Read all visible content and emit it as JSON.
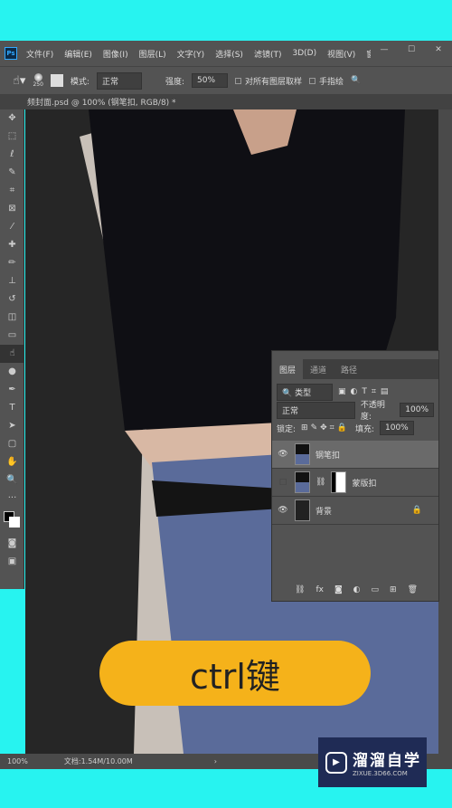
{
  "menubar": {
    "logo": "Ps",
    "items": [
      "文件(F)",
      "编辑(E)",
      "图像(I)",
      "图层(L)",
      "文字(Y)",
      "选择(S)",
      "滤镜(T)",
      "3D(D)",
      "视图(V)",
      "窗口("
    ],
    "win": [
      "—",
      "☐",
      "✕"
    ]
  },
  "options": {
    "brush_size": "250",
    "mode_label": "模式:",
    "mode_value": "正常",
    "strength_label": "强度:",
    "strength_value": "50%",
    "sample_all": "对所有图层取样",
    "finger": "手指绘"
  },
  "document": {
    "tab_title": "频封面.psd @ 100% (钢笔扣, RGB/8) *"
  },
  "layers_panel": {
    "tabs": [
      "图层",
      "通道",
      "路径"
    ],
    "filter": "类型",
    "blend_mode": "正常",
    "opacity_label": "不透明度:",
    "opacity": "100%",
    "lock_label": "锁定:",
    "fill_label": "填充:",
    "fill": "100%",
    "layers": [
      {
        "name": "钢笔扣",
        "visible": true,
        "selected": true
      },
      {
        "name": "蒙版扣",
        "visible": false,
        "selected": false,
        "mask": true
      },
      {
        "name": "背景",
        "visible": true,
        "selected": false,
        "locked": true
      }
    ]
  },
  "status": {
    "zoom": "100%",
    "doc": "文档:1.54M/10.00M"
  },
  "caption": "ctrl键",
  "watermark": {
    "name": "溜溜自学",
    "url": "ZIXUE.3D66.COM"
  },
  "colors": {
    "ps_bg": "#535353",
    "accent": "#f5b21a",
    "frame": "#27f3f0"
  }
}
